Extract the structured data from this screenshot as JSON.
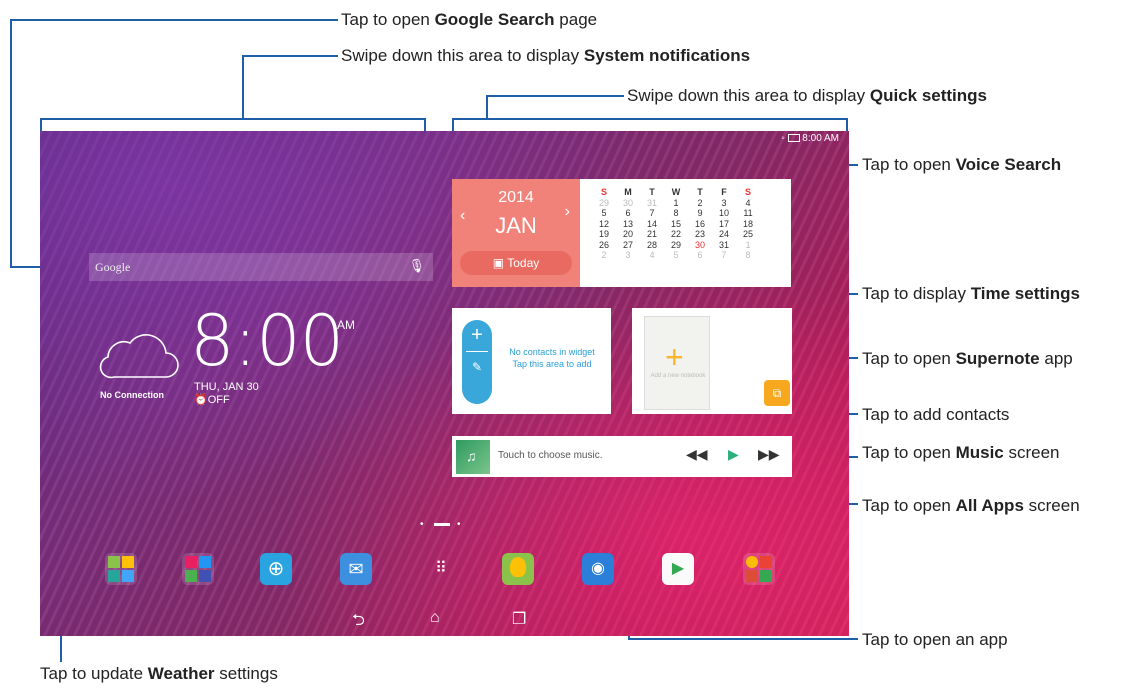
{
  "callouts": {
    "google_search": {
      "pre": "Tap to open ",
      "bold": "Google Search",
      "post": " page"
    },
    "system_notifications": {
      "pre": "Swipe down this area to display ",
      "bold": "System notifications",
      "post": ""
    },
    "quick_settings": {
      "pre": "Swipe down this area to display ",
      "bold": "Quick settings",
      "post": ""
    },
    "voice_search": {
      "pre": "Tap to open ",
      "bold": "Voice Search",
      "post": ""
    },
    "time_settings": {
      "pre": "Tap to display ",
      "bold": "Time settings",
      "post": ""
    },
    "supernote": {
      "pre": "Tap to open ",
      "bold": "Supernote",
      "post": " app"
    },
    "add_contacts": {
      "pre": "Tap to add contacts",
      "bold": "",
      "post": ""
    },
    "music": {
      "pre": "Tap to open ",
      "bold": "Music",
      "post": " screen"
    },
    "all_apps": {
      "pre": "Tap to open ",
      "bold": "All Apps",
      "post": " screen"
    },
    "open_app": {
      "pre": "Tap to open an app",
      "bold": "",
      "post": ""
    },
    "weather": {
      "pre": "Tap to update ",
      "bold": "Weather",
      "post": " settings"
    }
  },
  "status_bar": {
    "time": "8:00 AM"
  },
  "search_bar": {
    "brand": "Google"
  },
  "calendar": {
    "year": "2014",
    "month": "JAN",
    "today_label": "Today",
    "weekdays": [
      "S",
      "M",
      "T",
      "W",
      "T",
      "F",
      "S"
    ],
    "rows": [
      [
        "29",
        "30",
        "31",
        "1",
        "2",
        "3",
        "4"
      ],
      [
        "5",
        "6",
        "7",
        "8",
        "9",
        "10",
        "11"
      ],
      [
        "12",
        "13",
        "14",
        "15",
        "16",
        "17",
        "18"
      ],
      [
        "19",
        "20",
        "21",
        "22",
        "23",
        "24",
        "25"
      ],
      [
        "26",
        "27",
        "28",
        "29",
        "30",
        "31",
        "1"
      ],
      [
        "2",
        "3",
        "4",
        "5",
        "6",
        "7",
        "8"
      ]
    ]
  },
  "clock": {
    "time": "8:00",
    "ampm": "AM",
    "date": "THU, JAN 30",
    "alarm": "OFF"
  },
  "weather": {
    "status": "No Connection"
  },
  "contacts_widget": {
    "line1": "No contacts in widget",
    "line2": "Tap this area to add"
  },
  "supernote_widget": {
    "add_label": "Add a new notebook"
  },
  "music_widget": {
    "prompt": "Touch to choose music."
  },
  "colors": {
    "accent_line": "#1f5fa8",
    "calendar_red": "#f0827a",
    "contacts_blue": "#39a7d9",
    "supernote_orange": "#f7a81f"
  },
  "dock": [
    "asus-folder-icon",
    "tools-folder-icon",
    "browser-icon",
    "email-icon",
    "all-apps-icon",
    "weather-app-icon",
    "camera-icon",
    "play-store-icon",
    "google-folder-icon"
  ]
}
